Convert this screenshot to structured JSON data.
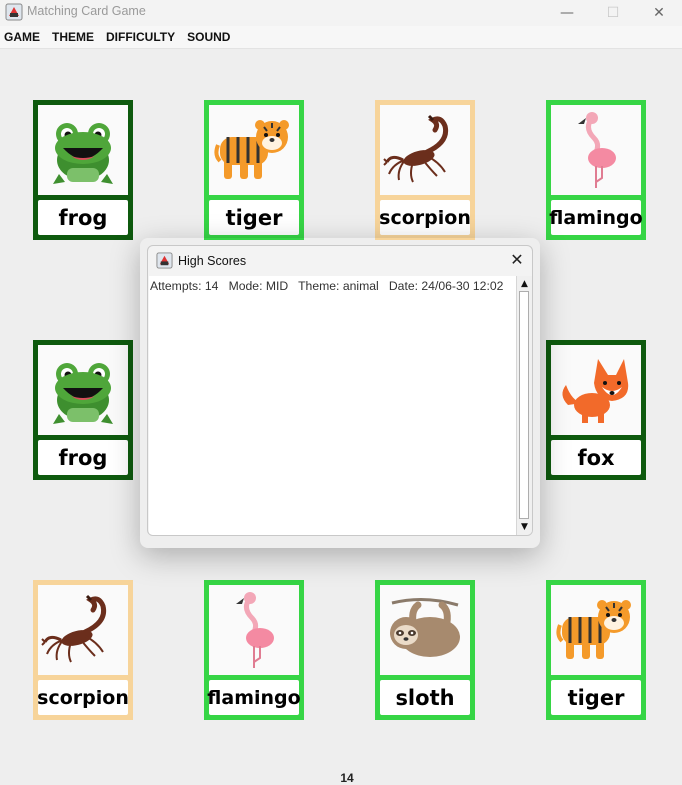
{
  "window": {
    "title": "Matching Card Game",
    "minimize_label": "—",
    "maximize_label": "☐",
    "close_label": "✕"
  },
  "menu": [
    "GAME",
    "THEME",
    "DIFFICULTY",
    "SOUND"
  ],
  "cards": [
    {
      "label": "frog",
      "animal": "frog-icon",
      "state": "matched"
    },
    {
      "label": "tiger",
      "animal": "tiger-icon",
      "state": "revealed"
    },
    {
      "label": "scorpion",
      "animal": "scorpion-icon",
      "state": "selected"
    },
    {
      "label": "flamingo",
      "animal": "flamingo-icon",
      "state": "revealed"
    },
    {
      "label": "frog",
      "animal": "frog-icon",
      "state": "matched"
    },
    {
      "label": "fox",
      "animal": "fox-icon",
      "state": "matched"
    },
    {
      "label": "scorpion",
      "animal": "scorpion-icon",
      "state": "selected"
    },
    {
      "label": "flamingo",
      "animal": "flamingo-icon",
      "state": "revealed"
    },
    {
      "label": "sloth",
      "animal": "sloth-icon",
      "state": "revealed"
    },
    {
      "label": "tiger",
      "animal": "tiger-icon",
      "state": "revealed"
    }
  ],
  "dialog": {
    "title": "High Scores",
    "close_label": "✕",
    "scores": [
      "Attempts: 14   Mode: MID   Theme: animal   Date: 24/06-30 12:02"
    ]
  },
  "footer": {
    "attempts": "14"
  },
  "colors": {
    "matched_border": "#0e5a0e",
    "revealed_border": "#36d545",
    "selected_border": "#f7d49a",
    "background": "#eeeeee"
  }
}
